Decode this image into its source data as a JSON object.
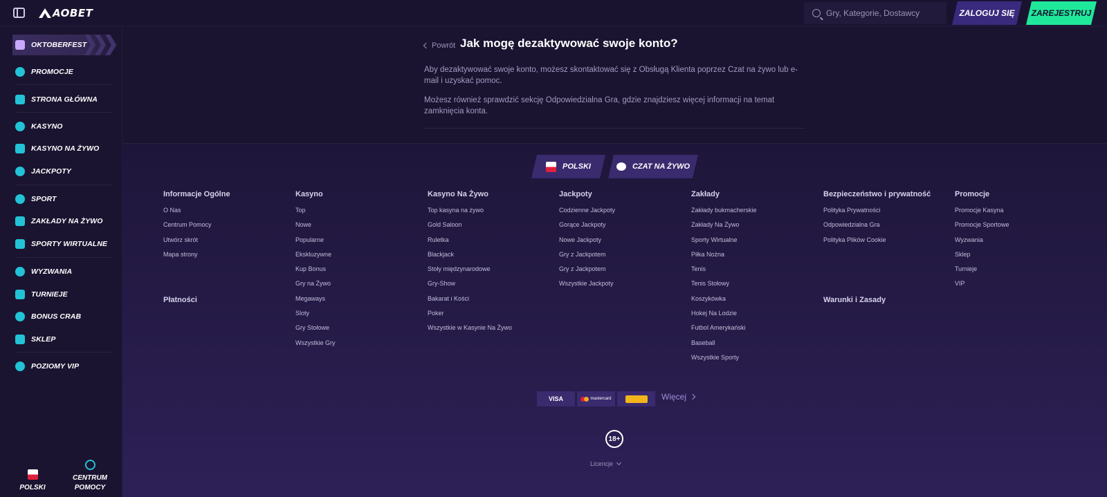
{
  "topbar": {
    "logo_text": "AOBET",
    "search_placeholder": "Gry, Kategorie, Dostawcy",
    "login_label": "ZALOGUJ SIĘ",
    "register_label": "ZAREJESTRUJ"
  },
  "sidebar": {
    "items": [
      {
        "label": "OKTOBERFEST",
        "icon": "beer-icon"
      },
      {
        "label": "PROMOCJE",
        "icon": "promo-icon"
      },
      {
        "label": "STRONA GŁÓWNA",
        "icon": "home-icon"
      },
      {
        "label": "KASYNO",
        "icon": "cherry-icon"
      },
      {
        "label": "KASYNO NA ŻYWO",
        "icon": "live-casino-icon"
      },
      {
        "label": "JACKPOTY",
        "icon": "clover-icon"
      },
      {
        "label": "SPORT",
        "icon": "sport-icon"
      },
      {
        "label": "ZAKŁADY NA ŻYWO",
        "icon": "live-bet-icon"
      },
      {
        "label": "SPORTY WIRTUALNE",
        "icon": "virtual-sport-icon"
      },
      {
        "label": "WYZWANIA",
        "icon": "challenge-icon"
      },
      {
        "label": "TURNIEJE",
        "icon": "trophy-icon"
      },
      {
        "label": "BONUS CRAB",
        "icon": "crab-icon"
      },
      {
        "label": "SKLEP",
        "icon": "shop-icon"
      },
      {
        "label": "POZIOMY VIP",
        "icon": "diamond-icon"
      }
    ],
    "bottom_language": "POLSKI",
    "bottom_help_line1": "CENTRUM",
    "bottom_help_line2": "POMOCY"
  },
  "article": {
    "back_label": "Powrót",
    "title": "Jak mogę dezaktywować swoje konto?",
    "paragraph1": "Aby dezaktywować swoje konto, możesz skontaktować się z Obsługą Klienta poprzez Czat na żywo lub e-mail i uzyskać pomoc.",
    "paragraph2": "Możesz również sprawdzić sekcję Odpowiedzialna Gra, gdzie znajdziesz więcej informacji na temat zamknięcia konta."
  },
  "footer": {
    "language_button": "POLSKI",
    "chat_button": "CZAT NA ŻYWO",
    "columns": [
      {
        "head": "Informacje Ogólne",
        "links": [
          "O Nas",
          "Centrum Pomocy",
          "Utwórz skrót",
          "Mapa strony"
        ]
      },
      {
        "head": "Kasyno",
        "links": [
          "Top",
          "Nowe",
          "Popularne",
          "Ekskluzywne",
          "Kup Bonus",
          "Gry na Żywo",
          "Megaways",
          "Sloty",
          "Gry Stołowe",
          "Wszystkie Gry"
        ]
      },
      {
        "head": "Kasyno Na Żywo",
        "links": [
          "Top kasyna na żywo",
          "Gold Saloon",
          "Ruletka",
          "Blackjack",
          "Stoły międzynarodowe",
          "Gry-Show",
          "Bakarat i Kości",
          "Poker",
          "Wszystkie w Kasynie Na Żywo"
        ]
      },
      {
        "head": "Jackpoty",
        "links": [
          "Codzienne Jackpoty",
          "Gorące Jackpoty",
          "Nowe Jackpoty",
          "Gry z Jackpotem",
          "Gry z Jackpotem",
          "Wszystkie Jackpoty"
        ]
      },
      {
        "head": "Zakłady",
        "links": [
          "Zakłady bukmacherskie",
          "Zakłady Na Żywo",
          "Sporty Wirtualne",
          "Piłka Nożna",
          "Tenis",
          "Tenis Stołowy",
          "Koszykówka",
          "Hokej Na Lodzie",
          "Futbol Amerykański",
          "Baseball",
          "Wszystkie Sporty"
        ]
      },
      {
        "head": "Bezpieczeństwo i prywatność",
        "links": [
          "Polityka Prywatności",
          "Odpowiedzialna Gra",
          "Polityka Plików Cookie"
        ]
      },
      {
        "head": "Promocje",
        "links": [
          "Promocje Kasyna",
          "Promocje Sportowe",
          "Wyzwania",
          "Sklep",
          "Turnieje",
          "VIP"
        ]
      }
    ],
    "payments_head": "Płatności",
    "terms_head": "Warunki i Zasady",
    "payment_methods": [
      "VISA",
      "mastercard",
      ""
    ],
    "more_label": "Więcej",
    "age_badge": "18+",
    "license_label": "Licencje"
  },
  "colors": {
    "accent_green": "#1fe89a",
    "accent_purple": "#3a2a7d",
    "icon_cyan": "#22c3d6"
  }
}
